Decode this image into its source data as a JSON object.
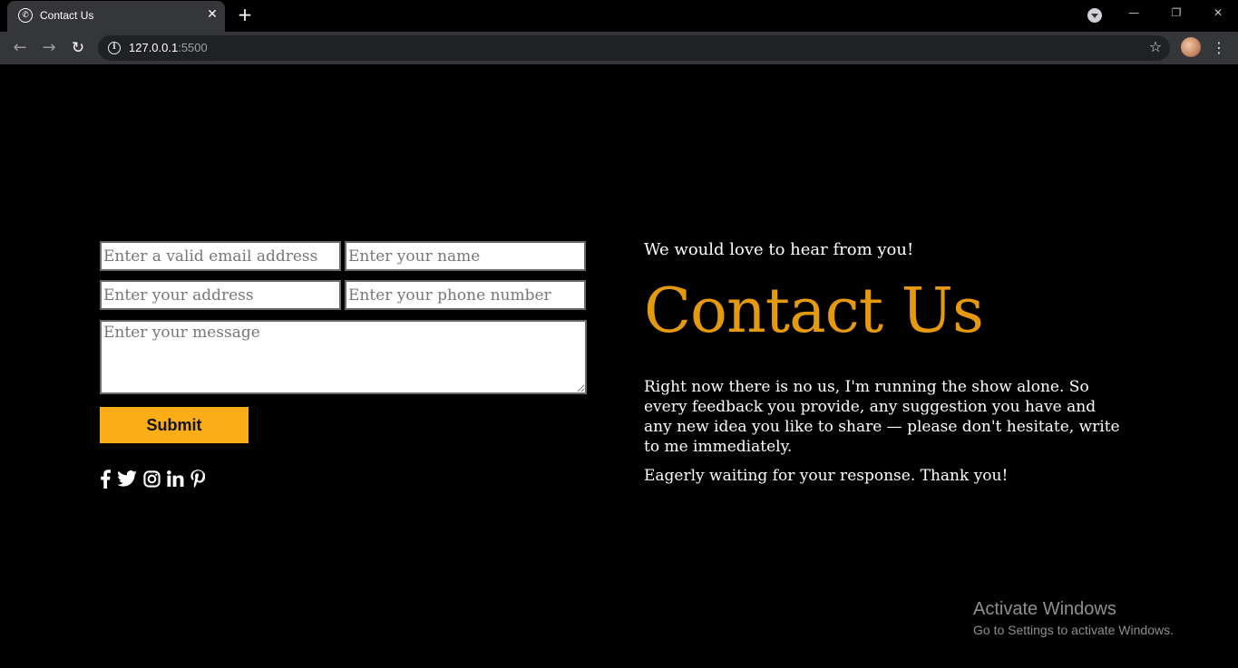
{
  "browser": {
    "tab_title": "Contact Us",
    "url_host": "127.0.0.1",
    "url_port": ":5500"
  },
  "form": {
    "email_placeholder": "Enter a valid email address",
    "name_placeholder": "Enter your name",
    "address_placeholder": "Enter your address",
    "phone_placeholder": "Enter your phone number",
    "message_placeholder": "Enter your message",
    "submit_label": "Submit"
  },
  "socials": [
    "facebook-icon",
    "twitter-icon",
    "instagram-icon",
    "linkedin-icon",
    "pinterest-icon"
  ],
  "info": {
    "subheading": "We would love to hear from you!",
    "heading": "Contact Us",
    "body": "Right now there is no us, I'm running the show alone. So every feedback you provide, any suggestion you have and any new idea you like to share — please don't hesitate, write to me immediately.",
    "closing": "Eagerly waiting for your response. Thank you!"
  },
  "watermark": {
    "title": "Activate Windows",
    "subtitle": "Go to Settings to activate Windows."
  },
  "colors": {
    "accent": "#e49a0c",
    "button": "#fbad18",
    "background": "#000000"
  }
}
